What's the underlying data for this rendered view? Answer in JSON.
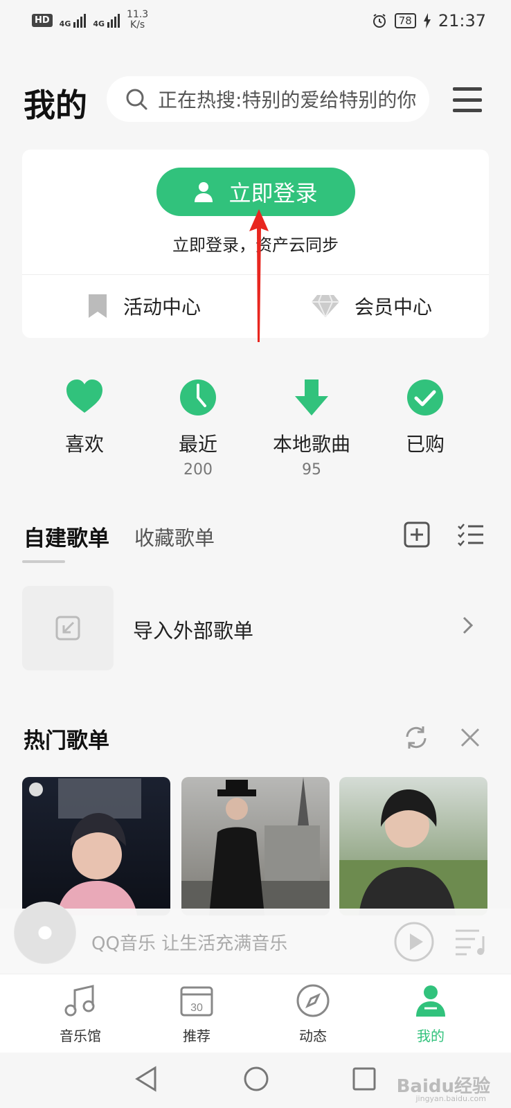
{
  "status_bar": {
    "hd_badge": "HD",
    "sim1_label": "4G",
    "sim2_label": "4G",
    "net_speed_value": "11.3",
    "net_speed_unit": "K/s",
    "battery": "78",
    "time": "21:37"
  },
  "header": {
    "title": "我的",
    "search_placeholder": "正在热搜:特别的爱给特别的你"
  },
  "login_card": {
    "login_button": "立即登录",
    "login_subtitle": "立即登录，资产云同步",
    "links": [
      {
        "label": "活动中心",
        "icon": "bookmark-icon"
      },
      {
        "label": "会员中心",
        "icon": "diamond-icon"
      }
    ]
  },
  "quick_entries": [
    {
      "label": "喜欢",
      "count": "",
      "icon": "heart-icon"
    },
    {
      "label": "最近",
      "count": "200",
      "icon": "clock-icon"
    },
    {
      "label": "本地歌曲",
      "count": "95",
      "icon": "download-icon"
    },
    {
      "label": "已购",
      "count": "",
      "icon": "check-circle-icon"
    }
  ],
  "playlists": {
    "tab_active": "自建歌单",
    "tab_other": "收藏歌单",
    "import_label": "导入外部歌单"
  },
  "hot_playlists": {
    "title": "热门歌单"
  },
  "mini_player": {
    "text": "QQ音乐 让生活充满音乐"
  },
  "bottom_nav": [
    {
      "label": "音乐馆",
      "icon": "music-note-icon"
    },
    {
      "label": "推荐",
      "icon": "calendar-icon",
      "badge": "30"
    },
    {
      "label": "动态",
      "icon": "compass-icon"
    },
    {
      "label": "我的",
      "icon": "user-icon",
      "active": true
    }
  ],
  "watermark": {
    "text": "Baidu经验",
    "sub": "jingyan.baidu.com"
  },
  "colors": {
    "accent": "#31c27c",
    "background": "#f6f6f6"
  }
}
